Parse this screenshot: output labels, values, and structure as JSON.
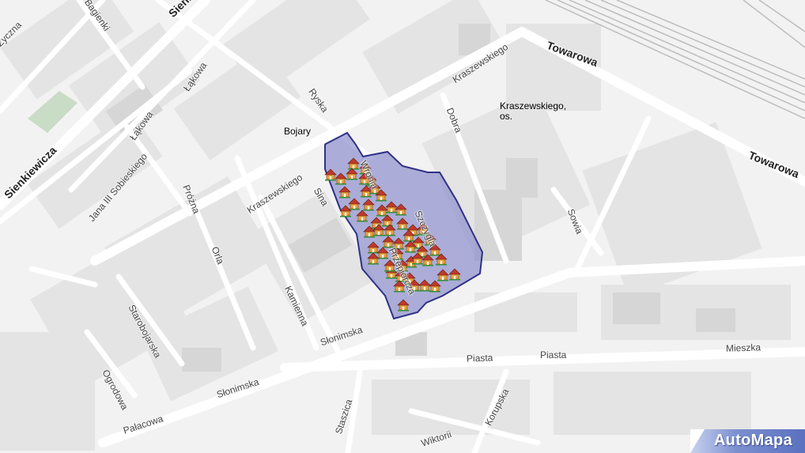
{
  "map": {
    "district": {
      "line1": "Kraszewskiego,",
      "line2": "os."
    },
    "places": {
      "bojary": "Bojary"
    },
    "streets": {
      "towarowa": "Towarowa",
      "towarowa_east": "Towarowa",
      "sienkiewicza": "Sienkiewicza",
      "sienkiewicza_top": "Sienk",
      "lakowa_top": "Łąkowa",
      "lakowa": "Łąkowa",
      "ryska": "Ryska",
      "kraszewskiego_ne": "Kraszewskiego",
      "kraszewskiego_w": "Kraszewskiego",
      "dobra": "Dobra",
      "daleka": "Daleka",
      "sowia": "Sowia",
      "jana_iii_sobieskiego": "Jana III Sobieskiego",
      "prozna": "Próżna",
      "sina": "Sina",
      "szczyglia": "Szczygla",
      "przepiorcza": "Przepiórcza",
      "wronia": "Wronia",
      "orla": "Orla",
      "kamienna": "Kamienna",
      "starobojarska": "Starobojarska",
      "ogrodowa": "Ogrodowa",
      "slonimska_upper": "Słonimska",
      "slonimska_lower": "Słonimska",
      "piasta_left": "Piasta",
      "piasta_right": "Piasta",
      "mieszka": "Mieszka",
      "palacowa": "Pałacowa",
      "staszica": "Staszica",
      "korupska": "Korupska",
      "wiktorii": "Wiktorii",
      "bagienki": "Bagienki",
      "zytnia": "Życzna"
    },
    "colors": {
      "background": "#f2f2f2",
      "road": "#ffffff",
      "block": "#e4e4e4",
      "building": "#dadada",
      "park": "#c9dcc5",
      "rail": "#bdbdbd",
      "area_fill": "#8d8fcc",
      "area_stroke": "#2f3185",
      "house_roof": "#c0392b",
      "house_wall": "#e8a13a"
    },
    "marker_icon": "house-icon",
    "house_count": 54
  },
  "brand": {
    "name": "AutoMapa"
  }
}
